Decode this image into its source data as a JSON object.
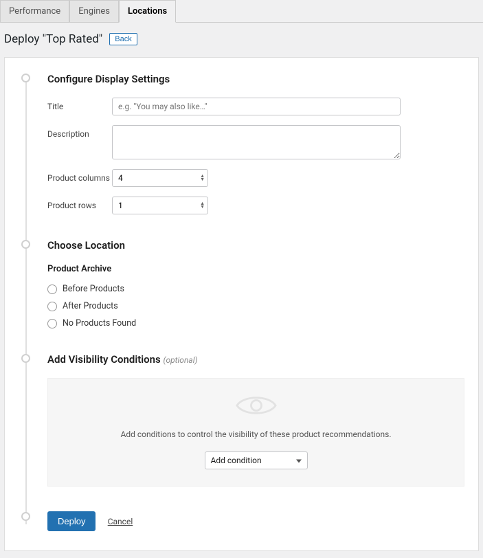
{
  "tabs": {
    "performance": "Performance",
    "engines": "Engines",
    "locations": "Locations"
  },
  "header": {
    "title": "Deploy \"Top Rated\"",
    "back": "Back"
  },
  "step1": {
    "title": "Configure Display Settings",
    "titleLabel": "Title",
    "titlePlaceholder": "e.g. \"You may also like…\"",
    "descLabel": "Description",
    "colsLabel": "Product columns",
    "colsValue": "4",
    "rowsLabel": "Product rows",
    "rowsValue": "1"
  },
  "step2": {
    "title": "Choose Location",
    "subheading": "Product Archive",
    "opt1": "Before Products",
    "opt2": "After Products",
    "opt3": "No Products Found"
  },
  "step3": {
    "title": "Add Visibility Conditions",
    "optional": "(optional)",
    "hint": "Add conditions to control the visibility of these product recommendations.",
    "addCondition": "Add condition"
  },
  "actions": {
    "deploy": "Deploy",
    "cancel": "Cancel"
  }
}
